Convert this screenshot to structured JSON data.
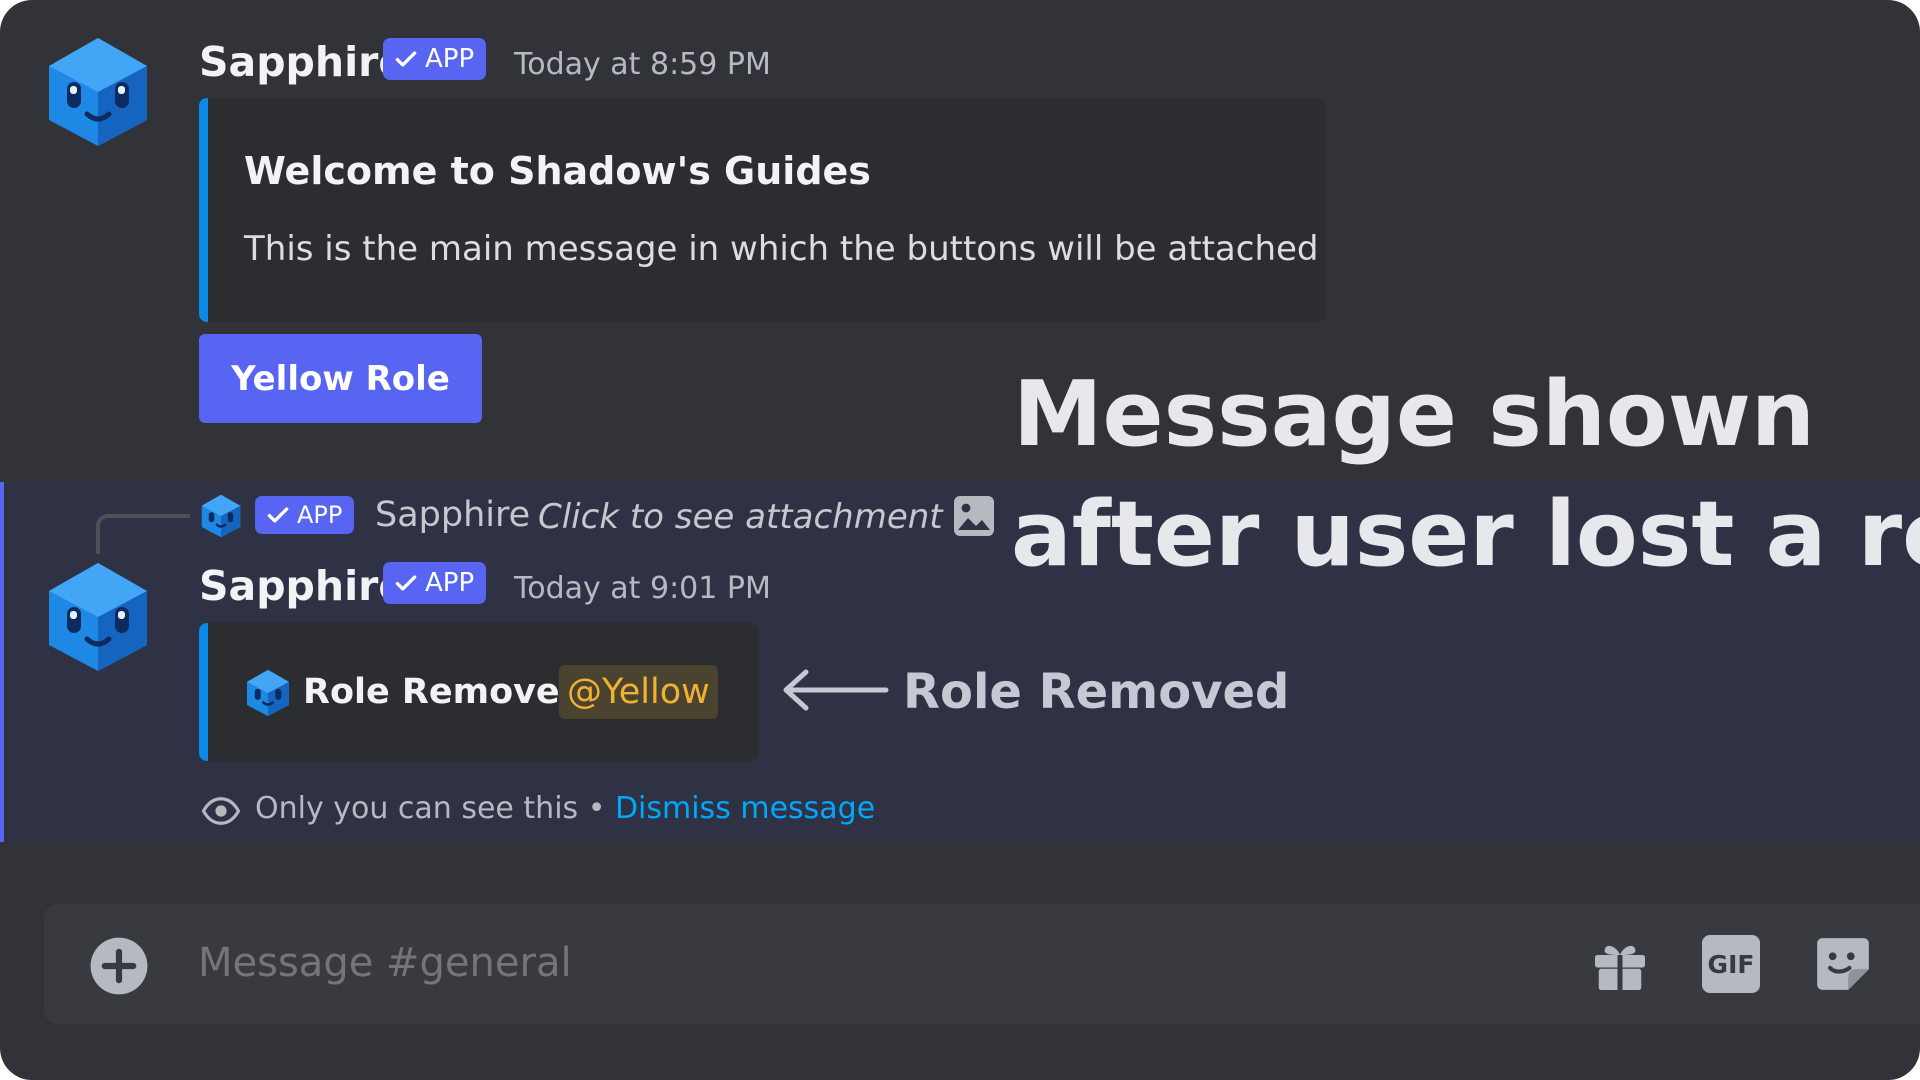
{
  "messages": [
    {
      "author": "Sapphire",
      "badge": "APP",
      "timestamp": "Today at 8:59 PM",
      "embed": {
        "title": "Welcome to Shadow's Guides",
        "description": "This is the main message in which the buttons will be attached"
      },
      "button_label": "Yellow Role"
    },
    {
      "reply": {
        "badge": "APP",
        "author": "Sapphire",
        "text": "Click to see attachment"
      },
      "author": "Sapphire",
      "badge": "APP",
      "timestamp": "Today at 9:01 PM",
      "embed": {
        "text": "Role Removed",
        "mention": "@Yellow"
      },
      "ephemeral": {
        "notice": "Only you can see this •",
        "dismiss": "Dismiss message"
      }
    }
  ],
  "annotation": {
    "headline_line1": "Message shown",
    "headline_line2": "after user lost a role",
    "arrow_label": "Role Removed"
  },
  "composer": {
    "placeholder": "Message #general",
    "gif_label": "GIF"
  },
  "colors": {
    "background": "#313338",
    "blurple": "#5865f2",
    "embed_bar": "#0a8ae6",
    "link": "#00a8fc",
    "mention_text": "#f0b232",
    "mention_bg": "#4a4330"
  }
}
